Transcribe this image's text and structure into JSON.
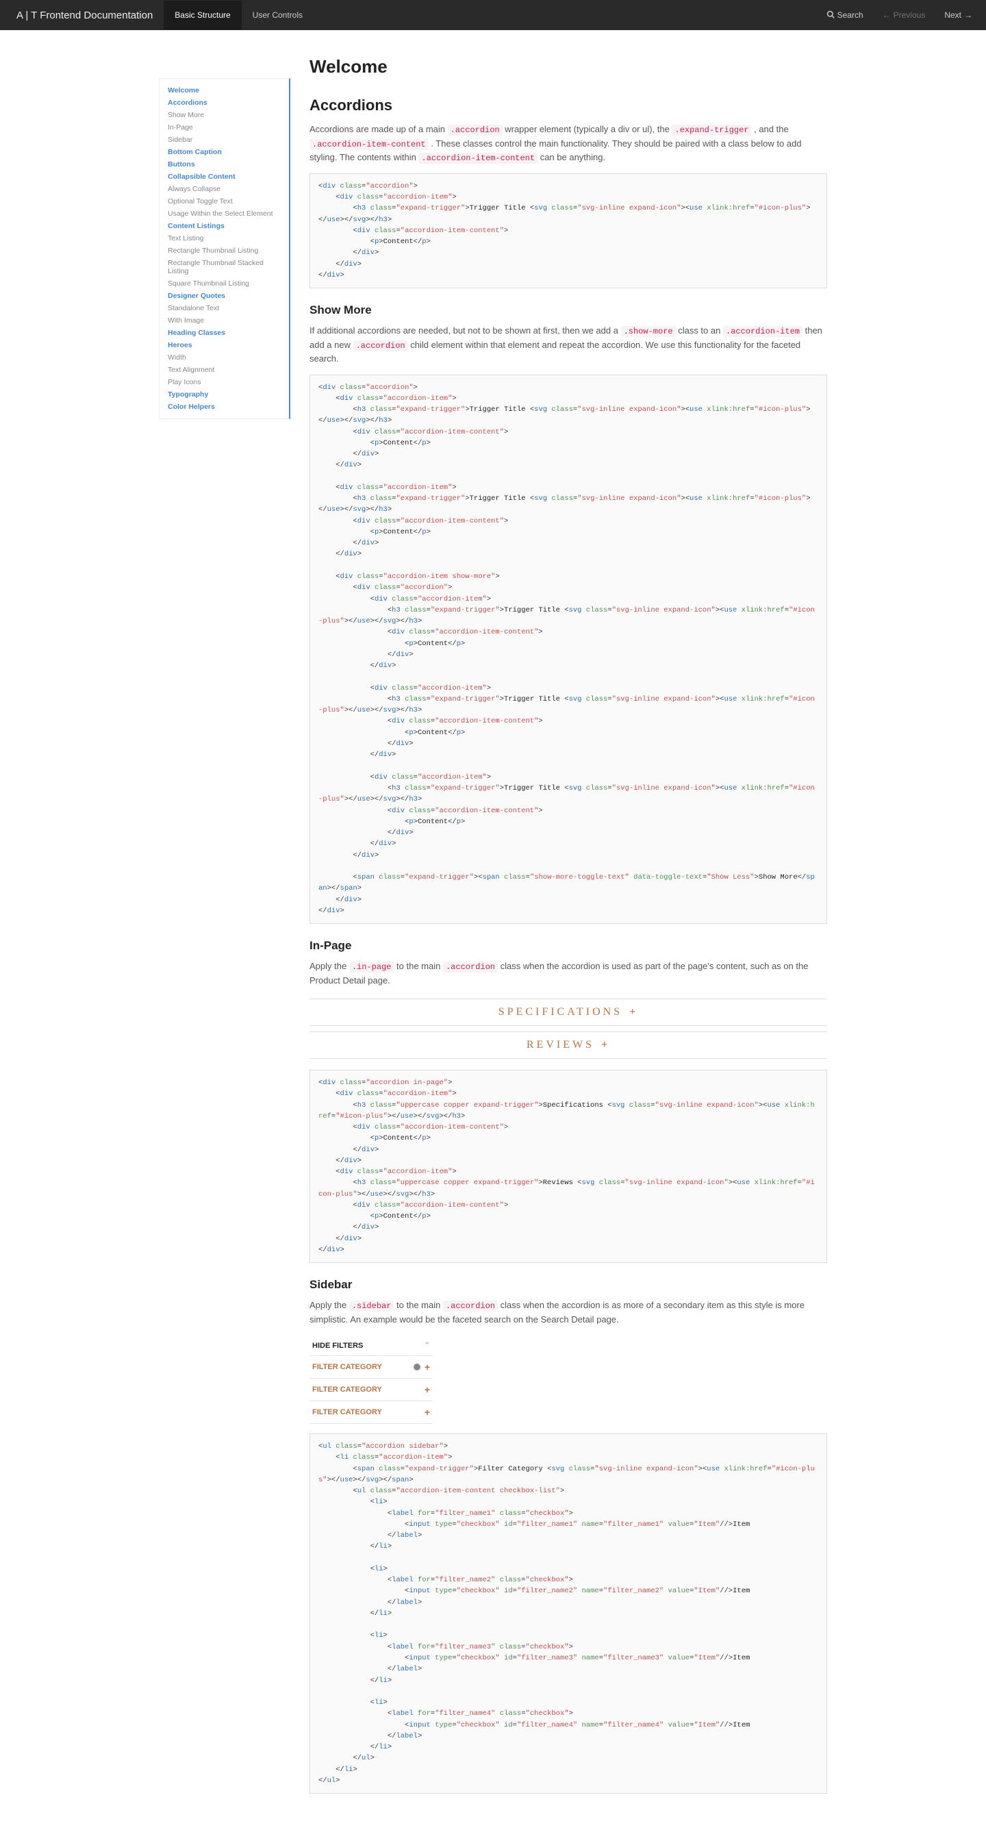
{
  "topnav": {
    "brand": "A | T Frontend Documentation",
    "tabs": [
      {
        "label": "Basic Structure",
        "active": true
      },
      {
        "label": "User Controls",
        "active": false
      }
    ],
    "search": "Search",
    "prev": "Previous",
    "next": "Next"
  },
  "sidenav": [
    {
      "label": "Welcome",
      "bold": true
    },
    {
      "label": "Accordions",
      "bold": true
    },
    {
      "label": "Show More",
      "sub": true
    },
    {
      "label": "In-Page",
      "sub": true
    },
    {
      "label": "Sidebar",
      "sub": true
    },
    {
      "label": "Bottom Caption",
      "bold": true
    },
    {
      "label": "Buttons",
      "bold": true
    },
    {
      "label": "Collapsible Content",
      "bold": true
    },
    {
      "label": "Always Collapse",
      "sub": true
    },
    {
      "label": "Optional Toggle Text",
      "sub": true
    },
    {
      "label": "Usage Within the Select Element",
      "sub": true
    },
    {
      "label": "Content Listings",
      "bold": true
    },
    {
      "label": "Text Listing",
      "sub": true
    },
    {
      "label": "Rectangle Thumbnail Listing",
      "sub": true
    },
    {
      "label": "Rectangle Thumbnail Stacked Listing",
      "sub": true
    },
    {
      "label": "Square Thumbnail Listing",
      "sub": true
    },
    {
      "label": "Designer Quotes",
      "bold": true
    },
    {
      "label": "Standalone Text",
      "sub": true
    },
    {
      "label": "With Image",
      "sub": true
    },
    {
      "label": "Heading Classes",
      "bold": true
    },
    {
      "label": "Heroes",
      "bold": true
    },
    {
      "label": "Width",
      "sub": true
    },
    {
      "label": "Text Alignment",
      "sub": true
    },
    {
      "label": "Play Icons",
      "sub": true
    },
    {
      "label": "Typography",
      "bold": true
    },
    {
      "label": "Color Helpers",
      "bold": true
    }
  ],
  "headings": {
    "welcome": "Welcome",
    "accordions": "Accordions",
    "showmore": "Show More",
    "inpage": "In-Page",
    "sidebar": "Sidebar"
  },
  "para": {
    "accordions_1a": "Accordions are made up of a main ",
    "accordions_1b": " wrapper element (typically a div or ul), the ",
    "accordions_1c": " , and the ",
    "accordions_1d": " . These classes control the main functionality. They should be paired with a class below to add styling. The contents within ",
    "accordions_1e": " can be anything.",
    "showmore_1a": "If additional accordions are needed, but not to be shown at first, then we add a ",
    "showmore_1b": " class to an ",
    "showmore_1c": " then add a new ",
    "showmore_1d": " child element within that element and repeat the accordion. We use this functionality for the faceted search.",
    "inpage_1a": "Apply the ",
    "inpage_1b": " to the main ",
    "inpage_1c": " class when the accordion is used as part of the page's content, such as on the Product Detail page.",
    "sidebar_1a": "Apply the ",
    "sidebar_1b": " to the main ",
    "sidebar_1c": " class when the accordion is as more of a secondary item as this style is more simplistic. An example would be the faceted search on the Search Detail page."
  },
  "codes": {
    "acc_class": ".accordion",
    "trig_class": ".expand-trigger",
    "content_class": ".accordion-item-content",
    "showmore_class": ".show-more",
    "item_class": ".accordion-item",
    "inpage_class": ".in-page",
    "sidebar_class": ".sidebar"
  },
  "demo_inpage": {
    "row1": "SPECIFICATIONS",
    "row2": "REVIEWS",
    "plus": "+"
  },
  "demo_sidebar": {
    "hide": "HIDE FILTERS",
    "cat": "FILTER CATEGORY",
    "plus": "+"
  },
  "code1": "<div class=\"accordion\">\n    <div class=\"accordion-item\">\n        <h3 class=\"expand-trigger\">Trigger Title <svg class=\"svg-inline expand-icon\"><use xlink:href=\"#icon-plus\"></use></svg></h3>\n        <div class=\"accordion-item-content\">\n            <p>Content</p>\n        </div>\n    </div>\n</div>",
  "code2": "<div class=\"accordion\">\n    <div class=\"accordion-item\">\n        <h3 class=\"expand-trigger\">Trigger Title <svg class=\"svg-inline expand-icon\"><use xlink:href=\"#icon-plus\"></use></svg></h3>\n        <div class=\"accordion-item-content\">\n            <p>Content</p>\n        </div>\n    </div>\n\n    <div class=\"accordion-item\">\n        <h3 class=\"expand-trigger\">Trigger Title <svg class=\"svg-inline expand-icon\"><use xlink:href=\"#icon-plus\"></use></svg></h3>\n        <div class=\"accordion-item-content\">\n            <p>Content</p>\n        </div>\n    </div>\n\n    <div class=\"accordion-item show-more\">\n        <div class=\"accordion\">\n            <div class=\"accordion-item\">\n                <h3 class=\"expand-trigger\">Trigger Title <svg class=\"svg-inline expand-icon\"><use xlink:href=\"#icon-plus\"></use></svg></h3>\n                <div class=\"accordion-item-content\">\n                    <p>Content</p>\n                </div>\n            </div>\n\n            <div class=\"accordion-item\">\n                <h3 class=\"expand-trigger\">Trigger Title <svg class=\"svg-inline expand-icon\"><use xlink:href=\"#icon-plus\"></use></svg></h3>\n                <div class=\"accordion-item-content\">\n                    <p>Content</p>\n                </div>\n            </div>\n\n            <div class=\"accordion-item\">\n                <h3 class=\"expand-trigger\">Trigger Title <svg class=\"svg-inline expand-icon\"><use xlink:href=\"#icon-plus\"></use></svg></h3>\n                <div class=\"accordion-item-content\">\n                    <p>Content</p>\n                </div>\n            </div>\n        </div>\n\n        <span class=\"expand-trigger\"><span class=\"show-more-toggle-text\" data-toggle-text=\"Show Less\">Show More</span></span>\n    </div>\n</div>",
  "code3": "<div class=\"accordion in-page\">\n    <div class=\"accordion-item\">\n        <h3 class=\"uppercase copper expand-trigger\">Specifications <svg class=\"svg-inline expand-icon\"><use xlink:href=\"#icon-plus\"></use></svg></h3>\n        <div class=\"accordion-item-content\">\n            <p>Content</p>\n        </div>\n    </div>\n    <div class=\"accordion-item\">\n        <h3 class=\"uppercase copper expand-trigger\">Reviews <svg class=\"svg-inline expand-icon\"><use xlink:href=\"#icon-plus\"></use></svg></h3>\n        <div class=\"accordion-item-content\">\n            <p>Content</p>\n        </div>\n    </div>\n</div>",
  "code4": "<ul class=\"accordion sidebar\">\n    <li class=\"accordion-item\">\n        <span class=\"expand-trigger\">Filter Category <svg class=\"svg-inline expand-icon\"><use xlink:href=\"#icon-plus\"></use></svg></span>\n        <ul class=\"accordion-item-content checkbox-list\">\n            <li>\n                <label for=\"filter_name1\" class=\"checkbox\">\n                    <input type=\"checkbox\" id=\"filter_name1\" name=\"filter_name1\" value=\"Item\"/>Item\n                </label>\n            </li>\n\n            <li>\n                <label for=\"filter_name2\" class=\"checkbox\">\n                    <input type=\"checkbox\" id=\"filter_name2\" name=\"filter_name2\" value=\"Item\"/>Item\n                </label>\n            </li>\n\n            <li>\n                <label for=\"filter_name3\" class=\"checkbox\">\n                    <input type=\"checkbox\" id=\"filter_name3\" name=\"filter_name3\" value=\"Item\"/>Item\n                </label>\n            </li>\n\n            <li>\n                <label for=\"filter_name4\" class=\"checkbox\">\n                    <input type=\"checkbox\" id=\"filter_name4\" name=\"filter_name4\" value=\"Item\"/>Item\n                </label>\n            </li>\n        </ul>\n    </li>\n</ul>"
}
